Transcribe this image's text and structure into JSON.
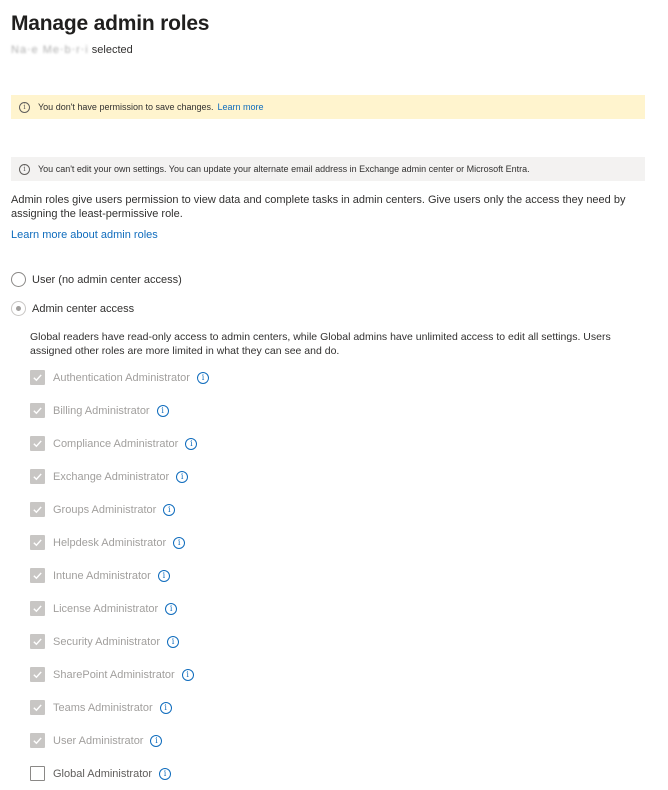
{
  "page": {
    "title": "Manage admin roles",
    "subtitle_redacted": "Na‧e Me‧b‧r‧i",
    "subtitle_suffix": "selected"
  },
  "banners": {
    "warning": {
      "icon": "info-icon",
      "text": "You don't have permission to save changes.",
      "link": "Learn more",
      "color": "#fff4ce"
    },
    "info": {
      "icon": "info-icon",
      "text": "You can't edit your own settings. You can update your alternate email address in Exchange admin center or Microsoft Entra.",
      "color": "#f3f2f1"
    }
  },
  "description": "Admin roles give users permission to view data and complete tasks in admin centers. Give users only the access they need by assigning the least-permissive role.",
  "learn_more_link": "Learn more about admin roles",
  "access_options": {
    "user": {
      "label": "User (no admin center access)",
      "selected": false
    },
    "admin": {
      "label": "Admin center access",
      "selected": true
    }
  },
  "admin_help": "Global readers have read-only access to admin centers, while Global admins have unlimited access to edit all settings. Users assigned other roles are more limited in what they can see and do.",
  "roles": [
    {
      "label": "Authentication Administrator",
      "checked": true
    },
    {
      "label": "Billing Administrator",
      "checked": true
    },
    {
      "label": "Compliance Administrator",
      "checked": true
    },
    {
      "label": "Exchange Administrator",
      "checked": true
    },
    {
      "label": "Groups Administrator",
      "checked": true
    },
    {
      "label": "Helpdesk Administrator",
      "checked": true
    },
    {
      "label": "Intune Administrator",
      "checked": true
    },
    {
      "label": "License Administrator",
      "checked": true
    },
    {
      "label": "Security Administrator",
      "checked": true
    },
    {
      "label": "SharePoint Administrator",
      "checked": true
    },
    {
      "label": "Teams Administrator",
      "checked": true
    },
    {
      "label": "User Administrator",
      "checked": true
    },
    {
      "label": "Global Administrator",
      "checked": false
    }
  ],
  "colors": {
    "accent": "#0f6cbd",
    "disabled_text": "#a19f9d",
    "checkbox_disabled": "#c8c6c4"
  }
}
